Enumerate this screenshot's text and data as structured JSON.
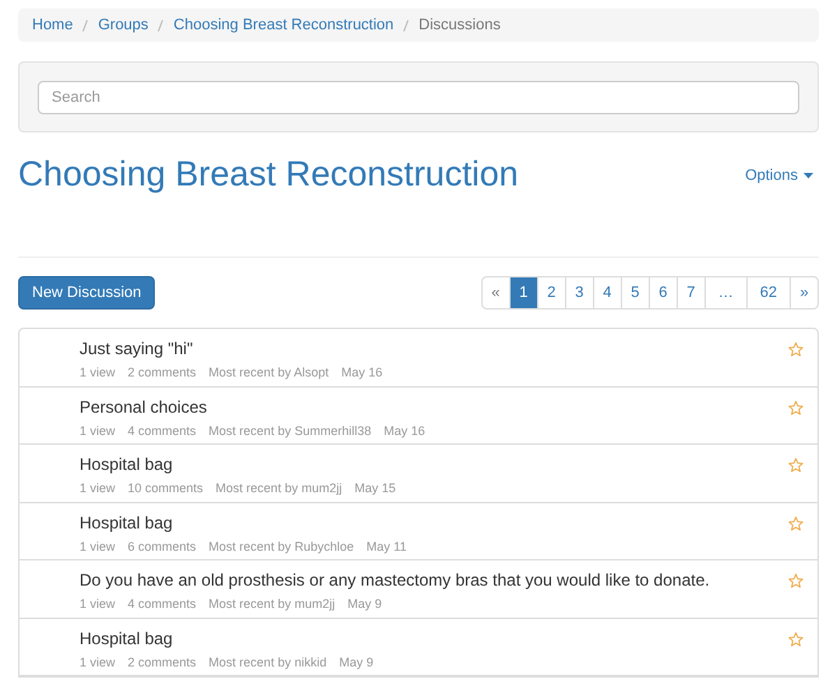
{
  "breadcrumb": [
    {
      "label": "Home",
      "active": false
    },
    {
      "label": "Groups",
      "active": false
    },
    {
      "label": "Choosing Breast Reconstruction",
      "active": false
    },
    {
      "label": "Discussions",
      "active": true
    }
  ],
  "search": {
    "placeholder": "Search"
  },
  "group_title": "Choosing Breast Reconstruction",
  "options_menu": {
    "label": "Options"
  },
  "new_discussion_button": "New Discussion",
  "pagination": [
    {
      "label": "«",
      "selected": false
    },
    {
      "label": "1",
      "selected": true
    },
    {
      "label": "2",
      "selected": false
    },
    {
      "label": "3",
      "selected": false
    },
    {
      "label": "4",
      "selected": false
    },
    {
      "label": "5",
      "selected": false
    },
    {
      "label": "6",
      "selected": false
    },
    {
      "label": "7",
      "selected": false
    },
    {
      "label": "…",
      "selected": false
    },
    {
      "label": "62",
      "selected": false
    },
    {
      "label": "»",
      "selected": false
    }
  ],
  "discussions": [
    {
      "title": "Just saying \"hi\"",
      "views": "1 view",
      "comments": "2 comments",
      "most_recent": "Most recent by Alsopt",
      "date": "May 16",
      "starred": false
    },
    {
      "title": "Personal choices",
      "views": "1 view",
      "comments": "4 comments",
      "most_recent": "Most recent by Summerhill38",
      "date": "May 16",
      "starred": false
    },
    {
      "title": "Hospital bag",
      "views": "1 view",
      "comments": "10 comments",
      "most_recent": "Most recent by mum2jj",
      "date": "May 15",
      "starred": false
    },
    {
      "title": "Hospital bag",
      "views": "1 view",
      "comments": "6 comments",
      "most_recent": "Most recent by Rubychloe",
      "date": "May 11",
      "starred": false
    },
    {
      "title": "Do you have an old prosthesis or any mastectomy bras that you would like to donate.",
      "views": "1 view",
      "comments": "4 comments",
      "most_recent": "Most recent by mum2jj",
      "date": "May 9",
      "starred": false
    },
    {
      "title": "Hospital bag",
      "views": "1 view",
      "comments": "2 comments",
      "most_recent": "Most recent by nikkid",
      "date": "May 9",
      "starred": false
    }
  ]
}
